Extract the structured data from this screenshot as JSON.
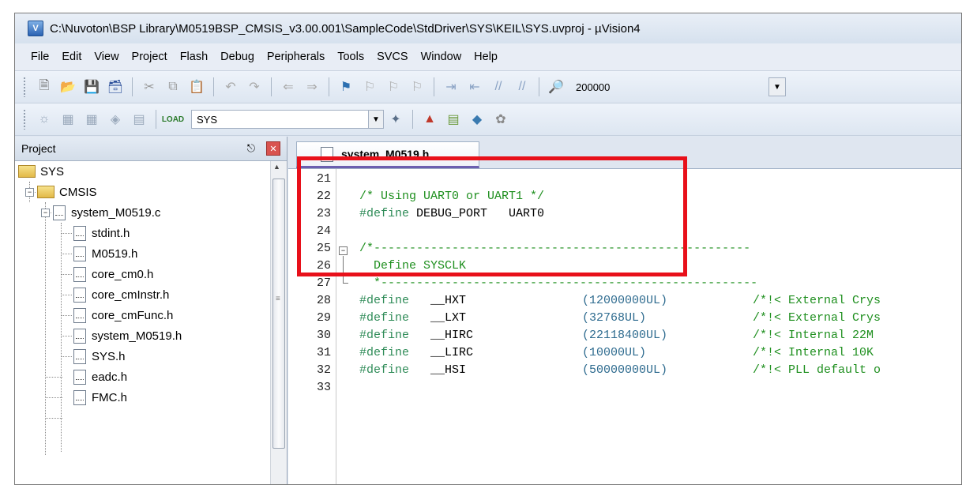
{
  "window": {
    "title": "C:\\Nuvoton\\BSP Library\\M0519BSP_CMSIS_v3.00.001\\SampleCode\\StdDriver\\SYS\\KEIL\\SYS.uvproj - µVision4"
  },
  "menu": {
    "items": [
      {
        "label": "File"
      },
      {
        "label": "Edit"
      },
      {
        "label": "View"
      },
      {
        "label": "Project"
      },
      {
        "label": "Flash"
      },
      {
        "label": "Debug"
      },
      {
        "label": "Peripherals"
      },
      {
        "label": "Tools"
      },
      {
        "label": "SVCS"
      },
      {
        "label": "Window"
      },
      {
        "label": "Help"
      }
    ]
  },
  "toolbar": {
    "address_value": "200000",
    "target_value": "SYS"
  },
  "project_panel": {
    "title": "Project",
    "tree": {
      "root": "SYS",
      "group": "CMSIS",
      "source": "system_M0519.c",
      "files": [
        "stdint.h",
        "M0519.h",
        "core_cm0.h",
        "core_cmInstr.h",
        "core_cmFunc.h",
        "system_M0519.h",
        "SYS.h",
        "eadc.h",
        "FMC.h"
      ]
    }
  },
  "editor": {
    "tab_label": "system_M0519.h",
    "lines": [
      {
        "num": "21"
      },
      {
        "num": "22",
        "comment": "/* Using UART0 or UART1 */"
      },
      {
        "num": "23",
        "kw": "#define",
        "rest": " DEBUG_PORT   UART0"
      },
      {
        "num": "24"
      },
      {
        "num": "25",
        "comment": "/*-----------------------------------------------------"
      },
      {
        "num": "26",
        "comment": "  Define SYSCLK"
      },
      {
        "num": "27",
        "comment": "  *-----------------------------------------------------"
      },
      {
        "num": "28",
        "kw": "#define",
        "name": "   __HXT",
        "val": "(12000000UL)",
        "cmt": "/*!< External Crys"
      },
      {
        "num": "29",
        "kw": "#define",
        "name": "   __LXT",
        "val": "(32768UL)",
        "cmt": "/*!< External Crys"
      },
      {
        "num": "30",
        "kw": "#define",
        "name": "   __HIRC",
        "val": "(22118400UL)",
        "cmt": "/*!< Internal 22M"
      },
      {
        "num": "31",
        "kw": "#define",
        "name": "   __LIRC",
        "val": "(10000UL)",
        "cmt": "/*!< Internal 10K"
      },
      {
        "num": "32",
        "kw": "#define",
        "name": "   __HSI",
        "val": "(50000000UL)",
        "cmt": "/*!< PLL default o"
      },
      {
        "num": "33"
      }
    ]
  },
  "colors": {
    "highlight": "#e8101a",
    "comment": "#1e8f1e",
    "keyword": "#2e8b57",
    "number": "#2e6b8f"
  }
}
